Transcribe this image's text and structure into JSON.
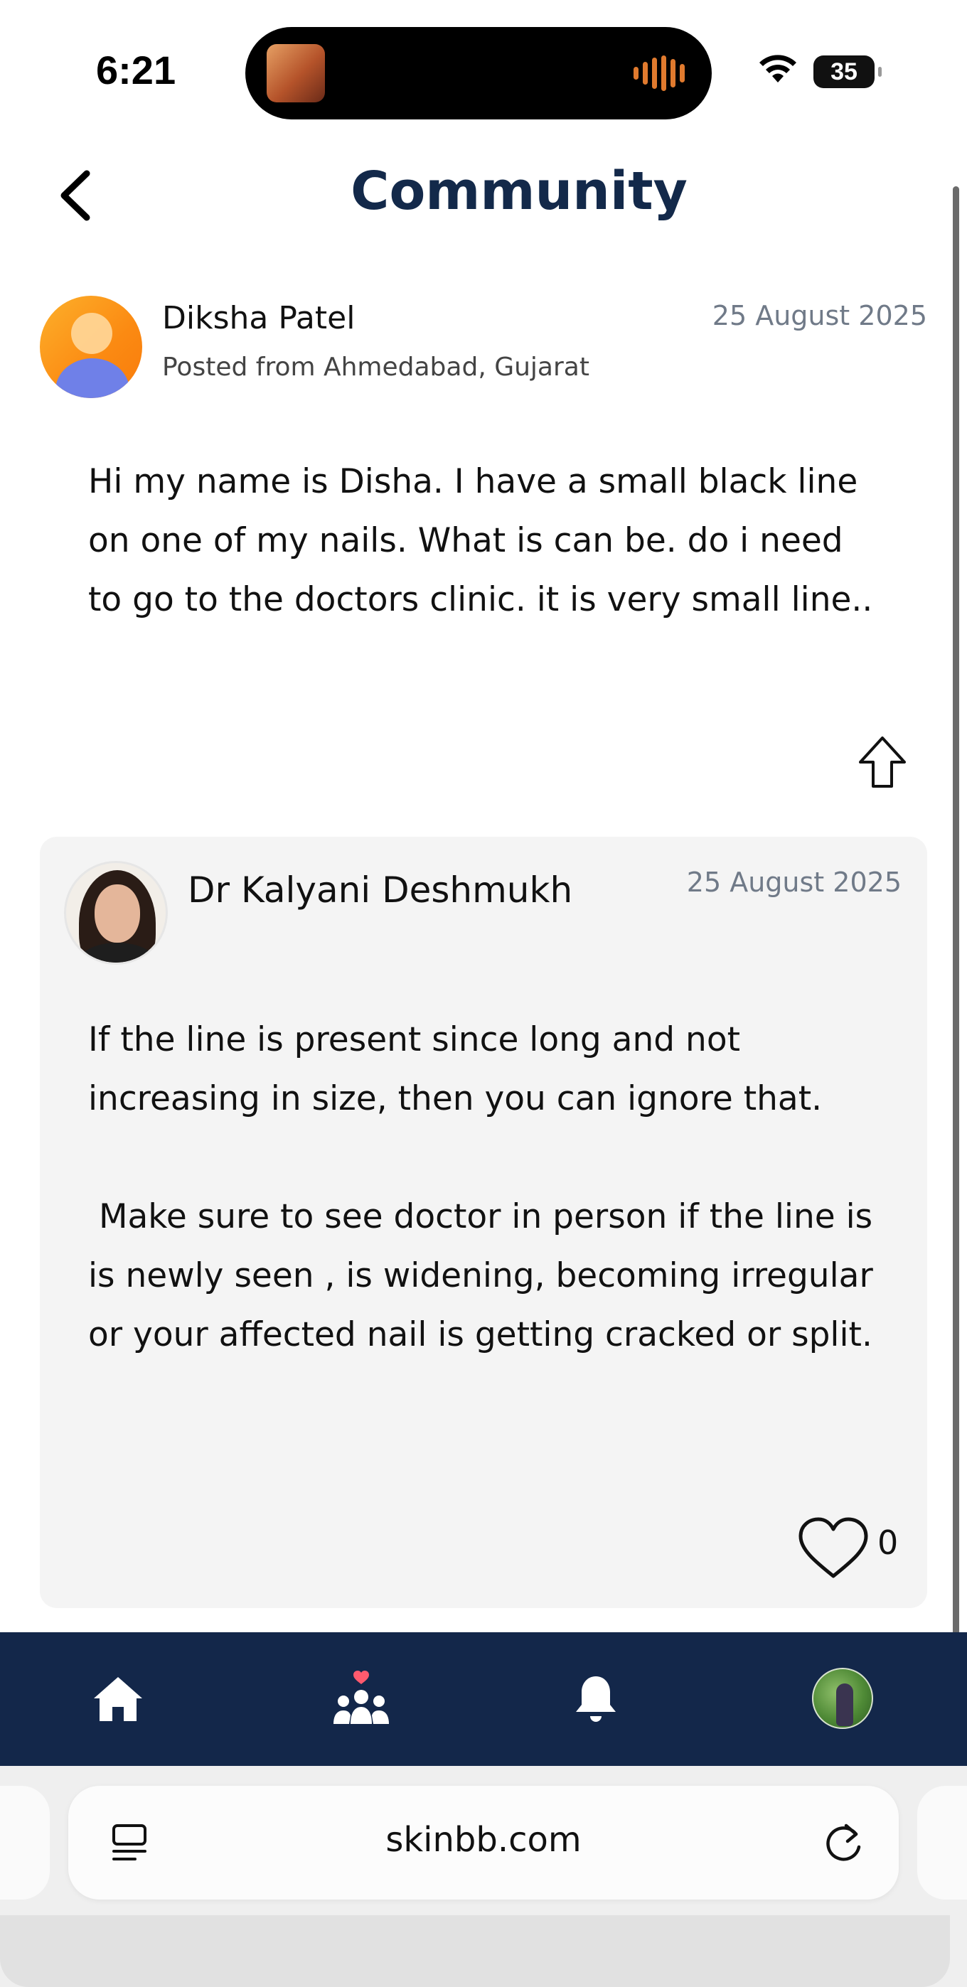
{
  "status_bar": {
    "time": "6:21",
    "battery": "35",
    "icons": [
      "wifi-icon",
      "battery-icon",
      "audio-wave-icon"
    ]
  },
  "header": {
    "title": "Community",
    "back_icon": "chevron-left-icon"
  },
  "post": {
    "author": "Diksha Patel",
    "location": "Posted from Ahmedabad, Gujarat",
    "date": "25 August 2025",
    "body": "Hi my name is Disha. I have a small black line on one of my nails. What is can be. do i need to go to the doctors clinic. it is very small line..",
    "share_icon": "share-arrow-up-icon"
  },
  "reply": {
    "doctor_name": "Dr Kalyani Deshmukh",
    "date": "25 August 2025",
    "body": "If the line is present since long and not increasing in size, then you can ignore that.\n\n Make sure to see doctor in person if the line is is newly seen , is widening, becoming irregular or your affected nail is getting cracked or split.",
    "like_count": "0",
    "like_icon": "heart-outline-icon"
  },
  "bottom_nav": {
    "items": [
      "home-icon",
      "community-icon",
      "bell-icon",
      "profile-avatar"
    ],
    "accent": "#13274a",
    "heart_color": "#ff5a6e"
  },
  "browser": {
    "url": "skinbb.com",
    "icons": [
      "reader-icon",
      "reload-icon"
    ]
  },
  "colors": {
    "title": "#13294a",
    "date": "#707a88",
    "card_bg": "#f4f4f4"
  }
}
